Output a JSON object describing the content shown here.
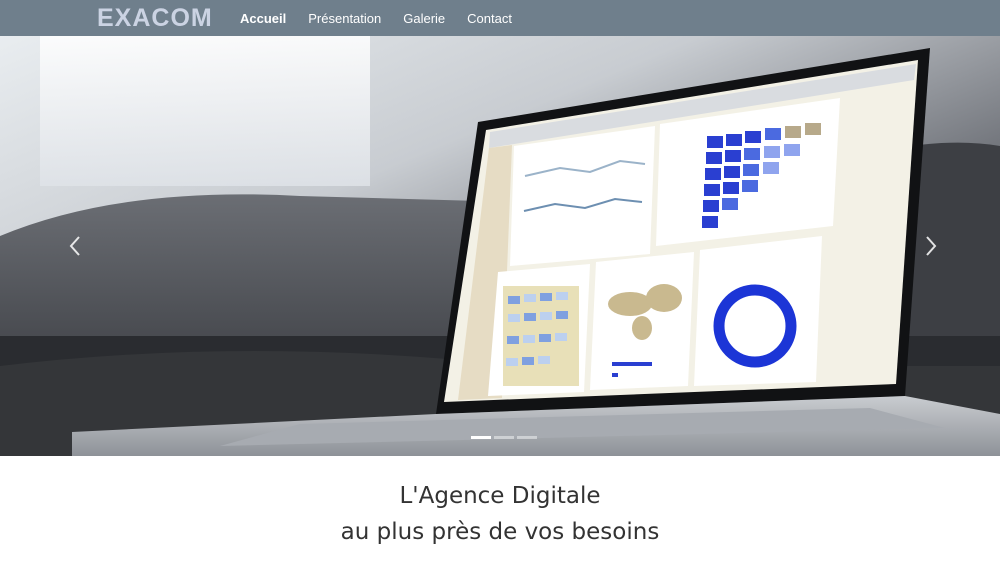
{
  "brand": "EXACOM",
  "nav": [
    {
      "label": "Accueil",
      "active": true
    },
    {
      "label": "Présentation",
      "active": false
    },
    {
      "label": "Galerie",
      "active": false
    },
    {
      "label": "Contact",
      "active": false
    }
  ],
  "carousel": {
    "slide_count": 3,
    "active_index": 0,
    "prev_icon": "chevron-left-icon",
    "next_icon": "chevron-right-icon"
  },
  "hero": {
    "line1": "L'Agence Digitale",
    "line2": "au plus près de vos besoins"
  },
  "colors": {
    "navbar_bg": "#6f7f8c",
    "brand": "#cbd3e3",
    "nav_text": "#ffffff",
    "tagline": "#333333"
  }
}
